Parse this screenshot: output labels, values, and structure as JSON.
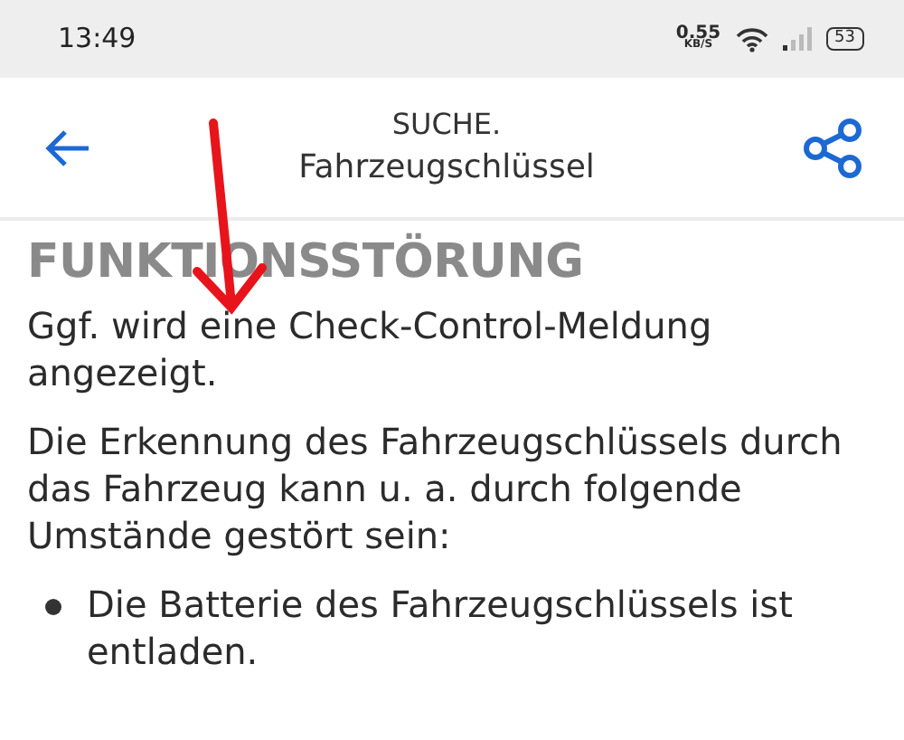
{
  "status_bar": {
    "time": "13:49",
    "speed": "0.55",
    "speed_unit": "KB/S",
    "battery": "53"
  },
  "header": {
    "title": "SUCHE.",
    "subtitle": "Fahrzeugschlüssel"
  },
  "heading": "FUNKTIONSSTÖRUNG",
  "paragraphs": [
    "Ggf. wird eine Check-Control-Meldung angezeigt.",
    "Die Erkennung des Fahrzeugschlüssels durch das Fahrzeug kann u. a. durch folgende Umstände gestört sein:"
  ],
  "bullets": [
    "Die Batterie des Fahrzeugschlüssels ist entladen."
  ],
  "annotation": {
    "kind": "arrow",
    "color": "#e8141b"
  }
}
